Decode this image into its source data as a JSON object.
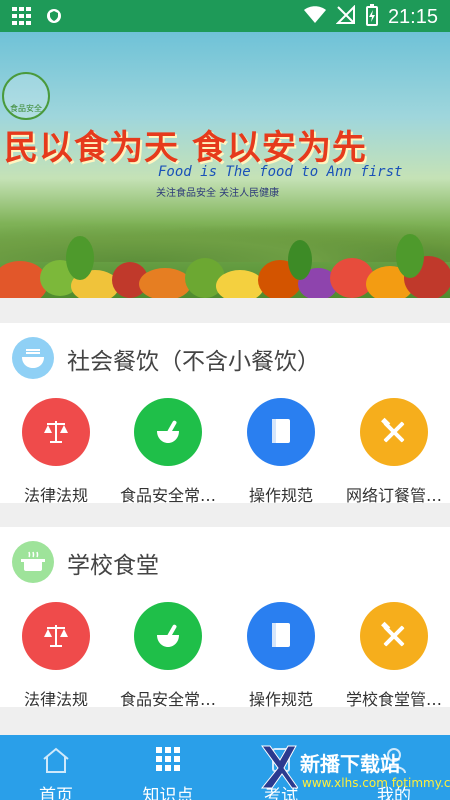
{
  "status_bar": {
    "time": "21:15",
    "icons": [
      "grid-icon",
      "shield-icon",
      "wifi-icon",
      "no-signal-icon",
      "battery-charging-icon"
    ]
  },
  "banner": {
    "slogan": "民以食为天 食以安为先",
    "english": "Food is The food to Ann first",
    "subtitle": "关注食品安全 关注人民健康",
    "logo_text": "食品安全"
  },
  "sections": [
    {
      "title": "社会餐饮（不含小餐饮）",
      "icon": "bowl-icon",
      "icon_color": "#8fd0f5",
      "items": [
        {
          "label": "法律法规",
          "icon": "scales-icon",
          "color": "red"
        },
        {
          "label": "食品安全常…",
          "icon": "mortar-icon",
          "color": "green"
        },
        {
          "label": "操作规范",
          "icon": "book-icon",
          "color": "blue"
        },
        {
          "label": "网络订餐管…",
          "icon": "tools-icon",
          "color": "yellow"
        }
      ]
    },
    {
      "title": "学校食堂",
      "icon": "pot-icon",
      "icon_color": "#9ee39a",
      "items": [
        {
          "label": "法律法规",
          "icon": "scales-icon",
          "color": "red"
        },
        {
          "label": "食品安全常…",
          "icon": "mortar-icon",
          "color": "green"
        },
        {
          "label": "操作规范",
          "icon": "book-icon",
          "color": "blue"
        },
        {
          "label": "学校食堂管…",
          "icon": "tools-icon",
          "color": "yellow"
        }
      ]
    }
  ],
  "bottom_nav": {
    "items": [
      {
        "label": "首页",
        "icon": "home-icon",
        "active": false
      },
      {
        "label": "知识点",
        "icon": "grid-icon",
        "active": true
      },
      {
        "label": "考试",
        "icon": "exam-icon",
        "active": false
      },
      {
        "label": "我的",
        "icon": "user-icon",
        "active": false
      }
    ]
  },
  "watermark": {
    "text": "新播下载站",
    "sub": "www.xlhs.com fotimmy.com"
  },
  "colors": {
    "status_bar": "#1e9a58",
    "nav": "#2a9fe9",
    "red": "#ef4b4b",
    "green": "#1fbf49",
    "blue": "#2a7ff0",
    "yellow": "#f6ae1c"
  }
}
